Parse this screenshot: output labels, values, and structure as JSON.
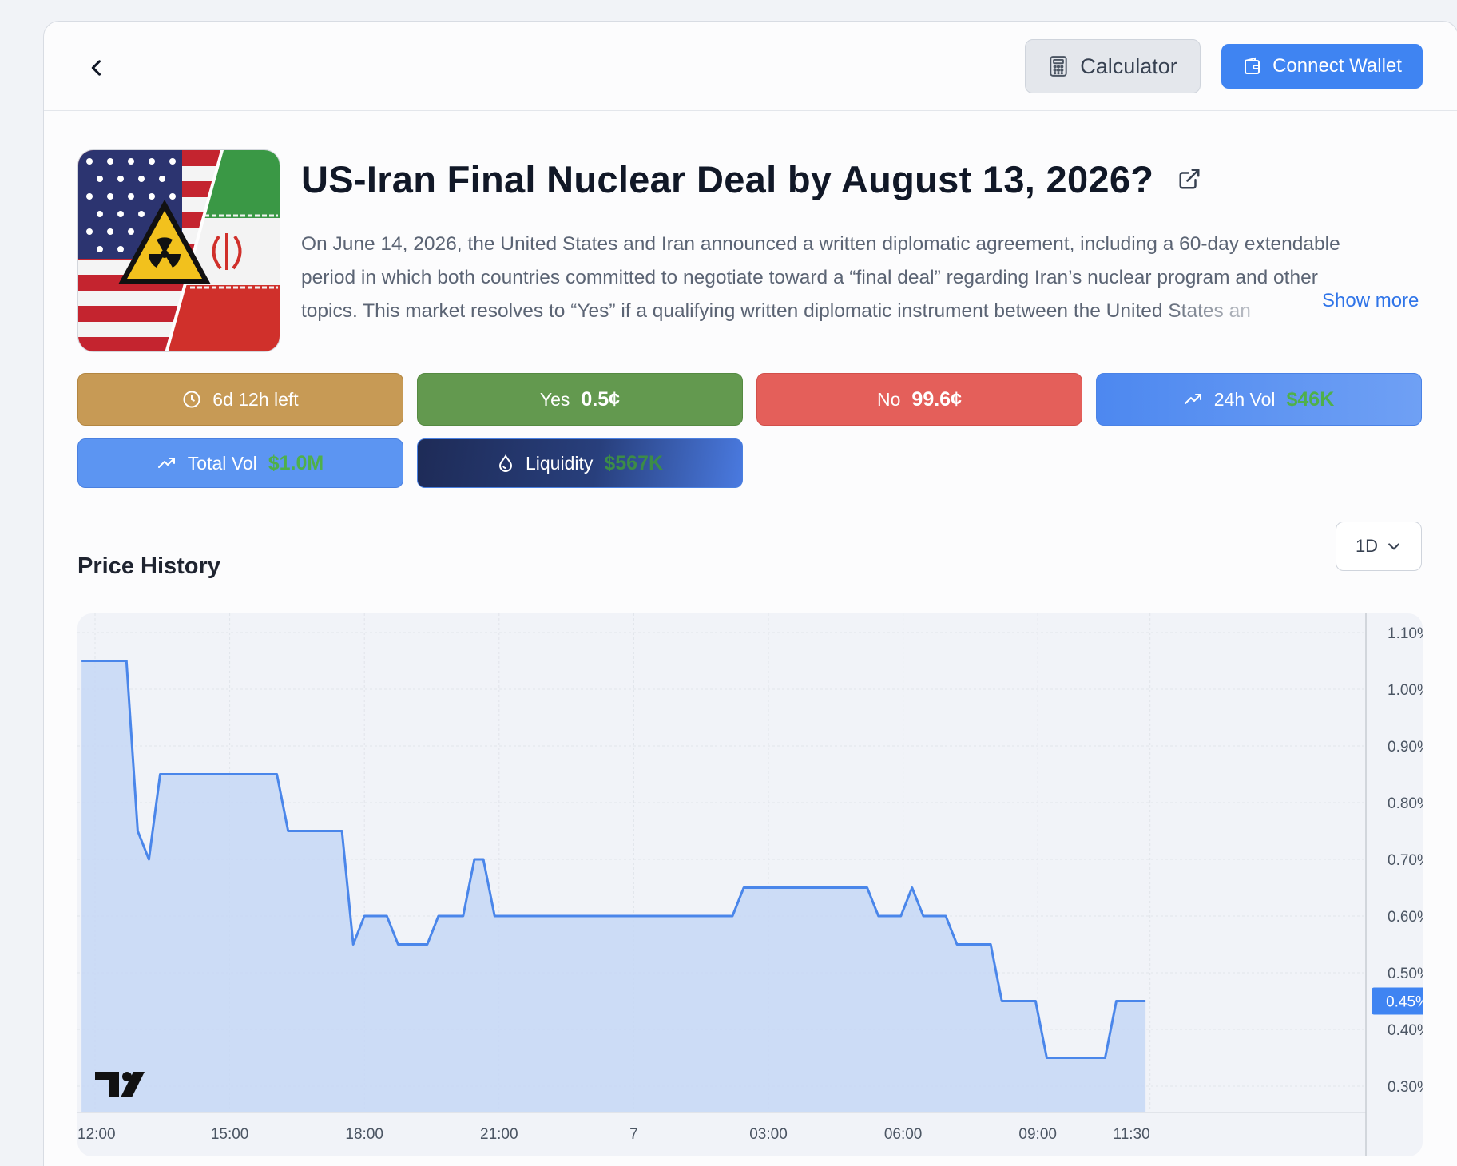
{
  "header": {
    "calculator_label": "Calculator",
    "connect_wallet_label": "Connect Wallet"
  },
  "market": {
    "title": "US-Iran Final Nuclear Deal by August 13, 2026?",
    "description_lines": [
      "On June 14, 2026, the United States and Iran announced a written diplomatic agreement, including a 60-day extendable",
      "period in which both countries committed to negotiate toward a “final deal” regarding Iran’s nuclear program and other",
      "topics. This market resolves to “Yes” if a qualifying written diplomatic instrument between the United States an"
    ],
    "show_more_label": "Show more"
  },
  "stats": {
    "time_left": "6d 12h left",
    "yes_label": "Yes",
    "yes_price": "0.5¢",
    "no_label": "No",
    "no_price": "99.6¢",
    "vol24_label": "24h Vol",
    "vol24_value": "$46K",
    "total_vol_label": "Total Vol",
    "total_vol_value": "$1.0M",
    "liquidity_label": "Liquidity",
    "liquidity_value": "$567K"
  },
  "price_history": {
    "title": "Price History",
    "range": "1D"
  },
  "colors": {
    "accent": "#3f84f2",
    "yes": "#63994f",
    "no": "#e45f5a",
    "time": "#c79a55",
    "line": "#4a86ea"
  },
  "icons": {
    "back": "chevron-left-icon",
    "calculator": "calculator-icon",
    "wallet": "wallet-icon",
    "external": "external-link-icon",
    "clock": "clock-icon",
    "trend": "trending-up-icon",
    "liquidity": "droplet-icon",
    "dropdown": "chevron-down-icon"
  },
  "chart_data": {
    "type": "area",
    "title": "",
    "xlabel": "",
    "ylabel": "",
    "x_tick_labels": [
      "12:00",
      "15:00",
      "18:00",
      "21:00",
      "7",
      "03:00",
      "06:00",
      "09:00",
      "11:30"
    ],
    "x_ticks_hours": [
      0,
      3,
      6,
      9,
      12,
      15,
      18,
      21,
      23.5
    ],
    "y_ticks": [
      0.3,
      0.4,
      0.5,
      0.6,
      0.7,
      0.8,
      0.9,
      1.0,
      1.1
    ],
    "y_tick_labels": [
      "0.30%",
      "0.40%",
      "0.50%",
      "0.60%",
      "0.70%",
      "0.80%",
      "0.90%",
      "1.00%",
      "1.10%"
    ],
    "ylim": [
      0.27,
      1.15
    ],
    "grid": true,
    "last_value_label": "0.45%",
    "series": [
      {
        "x_hours": [
          -0.3,
          0.7,
          0.95,
          1.2,
          1.45,
          4.05,
          4.3,
          5.5,
          5.75,
          6.0,
          6.5,
          6.75,
          7.4,
          7.65,
          8.2,
          8.45,
          8.65,
          8.9,
          9.3,
          10.0,
          11.5,
          14.2,
          14.45,
          17.2,
          17.45,
          17.95,
          18.2,
          18.45,
          18.95,
          19.2,
          19.95,
          20.2,
          20.95,
          21.2,
          22.5,
          22.75,
          23.0,
          23.25,
          23.4
        ],
        "values": [
          1.05,
          1.05,
          0.75,
          0.7,
          0.85,
          0.85,
          0.75,
          0.75,
          0.55,
          0.6,
          0.6,
          0.55,
          0.55,
          0.6,
          0.6,
          0.7,
          0.7,
          0.6,
          0.6,
          0.6,
          0.6,
          0.6,
          0.65,
          0.65,
          0.6,
          0.6,
          0.65,
          0.6,
          0.6,
          0.55,
          0.55,
          0.45,
          0.45,
          0.35,
          0.35,
          0.45,
          0.45,
          0.45,
          0.45
        ]
      }
    ]
  }
}
